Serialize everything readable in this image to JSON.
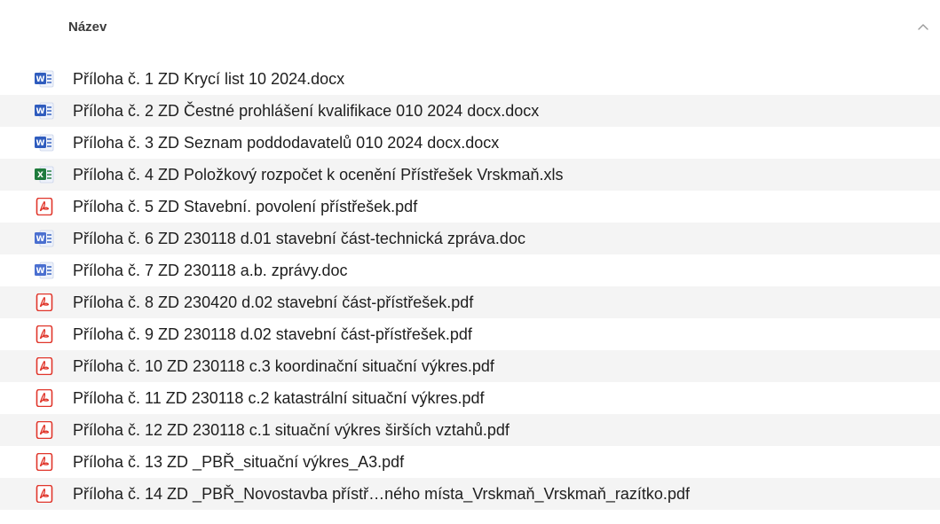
{
  "header": {
    "name_column": "Název"
  },
  "colors": {
    "word_blue": "#2f5cbe",
    "excel_green": "#1e7b3c",
    "pdf_red": "#e0362b",
    "row_alt": "#f4f4f4"
  },
  "files": [
    {
      "name": "Příloha č. 1 ZD Krycí list 10 2024.docx",
      "icon": "word-docx-icon"
    },
    {
      "name": "Příloha č. 2 ZD Čestné prohlášení  kvalifikace  010 2024 docx.docx",
      "icon": "word-docx-icon"
    },
    {
      "name": "Příloha č. 3 ZD Seznam poddodavatelů  010 2024 docx.docx",
      "icon": "word-docx-icon"
    },
    {
      "name": "Příloha č. 4 ZD Položkový rozpočet k ocenění Přístřešek Vrskmaň.xls",
      "icon": "excel-xls-icon"
    },
    {
      "name": "Příloha č. 5 ZD Stavební. povolení přístřešek.pdf",
      "icon": "pdf-icon"
    },
    {
      "name": "Příloha č. 6 ZD 230118 d.01 stavební část-technická zpráva.doc",
      "icon": "word-doc-icon"
    },
    {
      "name": "Příloha č. 7 ZD 230118 a.b. zprávy.doc",
      "icon": "word-doc-icon"
    },
    {
      "name": "Příloha č. 8 ZD 230420 d.02 stavební část-přístřešek.pdf",
      "icon": "pdf-icon"
    },
    {
      "name": "Příloha č. 9 ZD 230118 d.02 stavební část-přístřešek.pdf",
      "icon": "pdf-icon"
    },
    {
      "name": "Příloha č. 10 ZD 230118 c.3 koordinační situační výkres.pdf",
      "icon": "pdf-icon"
    },
    {
      "name": "Příloha č. 11 ZD 230118 c.2 katastrální situační výkres.pdf",
      "icon": "pdf-icon"
    },
    {
      "name": "Příloha č. 12 ZD 230118 c.1 situační výkres širších vztahů.pdf",
      "icon": "pdf-icon"
    },
    {
      "name": "Příloha č. 13 ZD _PBŘ_situační výkres_A3.pdf",
      "icon": "pdf-icon"
    },
    {
      "name": "Příloha č. 14 ZD _PBŘ_Novostavba přístř…ného místa_Vrskmaň_Vrskmaň_razítko.pdf",
      "icon": "pdf-icon"
    }
  ]
}
